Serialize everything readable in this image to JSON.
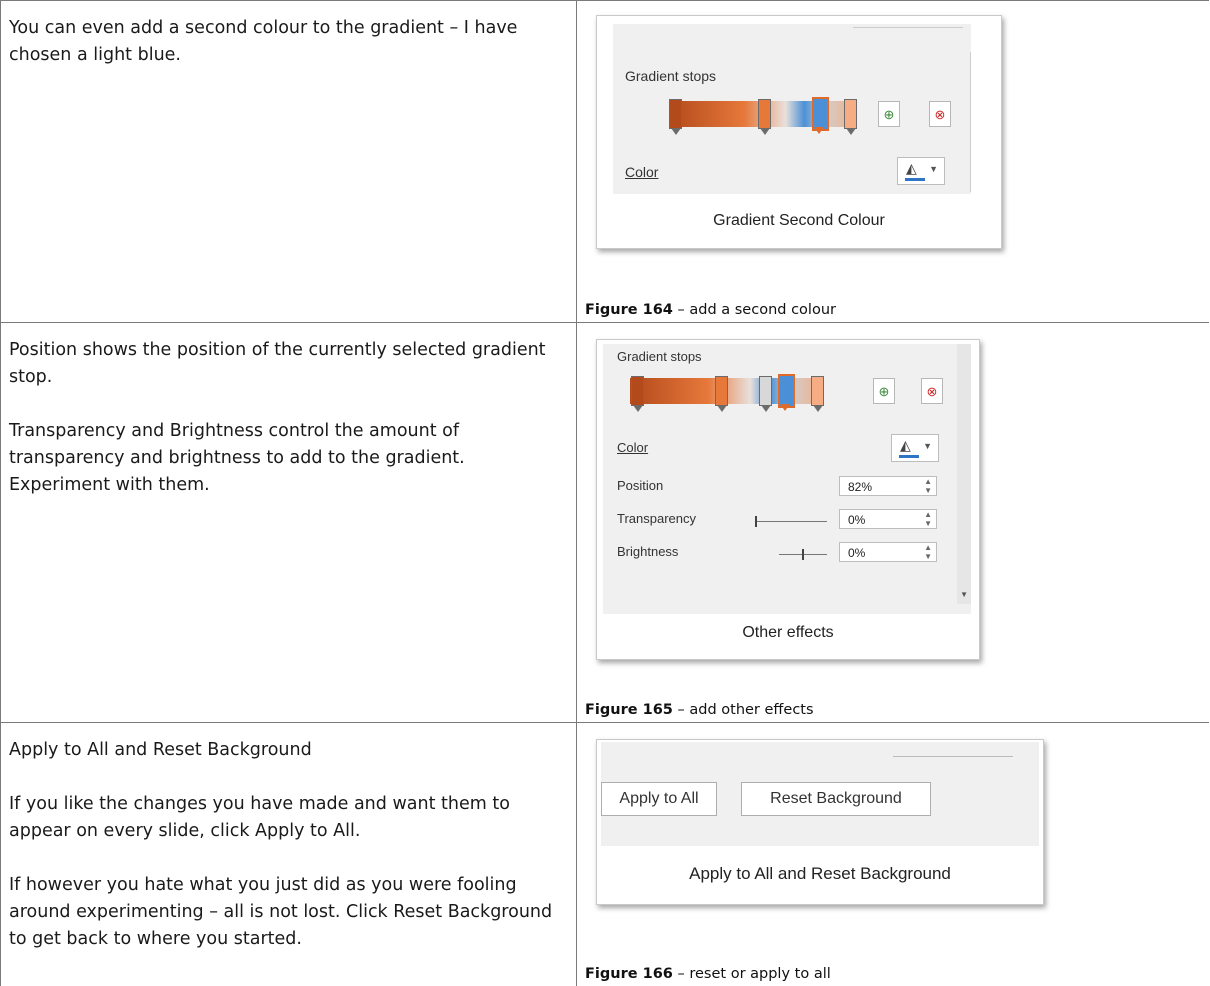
{
  "rows": [
    {
      "paragraphs": [
        "You can even add a second colour to the gradient – I have chosen a light blue."
      ],
      "figure": {
        "number": "Figure 164",
        "text": "– add a second colour",
        "screenshot": {
          "gradient_stops_label": "Gradient stops",
          "color_label": "Color",
          "caption": "Gradient Second Colour"
        }
      }
    },
    {
      "paragraphs": [
        "Position shows the position of the currently selected gradient stop.",
        "Transparency and Brightness control the amount of transparency and brightness to add to the gradient. Experiment with them."
      ],
      "figure": {
        "number": "Figure 165",
        "text": "– add other effects",
        "screenshot": {
          "gradient_stops_label": "Gradient stops",
          "color_label": "Color",
          "position_label": "Position",
          "position_value": "82%",
          "transparency_label": "Transparency",
          "transparency_value": "0%",
          "brightness_label": "Brightness",
          "brightness_value": "0%",
          "caption": "Other effects"
        }
      }
    },
    {
      "paragraphs": [
        "Apply to All and Reset Background",
        "If you like the changes you have made and want them to appear on every slide, click Apply to All.",
        "If however you hate what you just did as you were fooling around experimenting – all is not lost. Click Reset Background to get back to where you started."
      ],
      "figure": {
        "number": "Figure 166",
        "text": "– reset or apply to all",
        "screenshot": {
          "apply_all_label": "Apply to All",
          "reset_label": "Reset Background",
          "caption": "Apply to All and Reset Background"
        }
      }
    }
  ],
  "icons": {
    "add_stop": "add-gradient-stop-icon",
    "remove_stop": "remove-gradient-stop-icon",
    "fill_color": "paint-bucket-icon"
  },
  "colors": {
    "stop_dark_orange": "#b34a1c",
    "stop_orange": "#e6783a",
    "stop_blue": "#4b90d6",
    "stop_light_orange": "#f6ad84",
    "selected_stop_border": "#e06a2a",
    "color_underline": "#2e75c7"
  }
}
